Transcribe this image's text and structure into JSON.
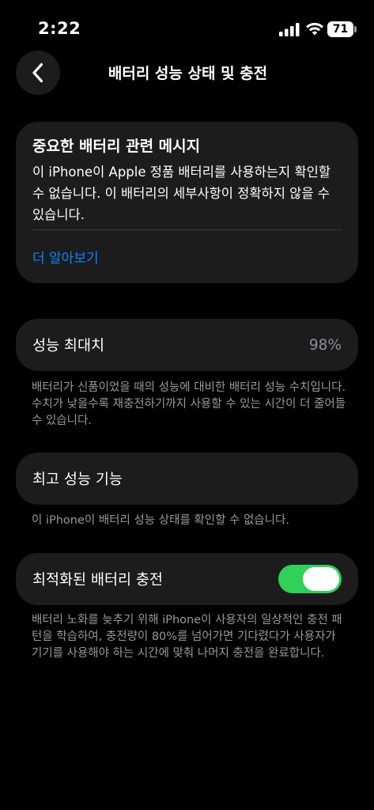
{
  "status_bar": {
    "time": "2:22",
    "battery_level": "71"
  },
  "nav": {
    "title": "배터리 성능 상태 및 충전"
  },
  "important_message": {
    "title": "중요한 배터리 관련 메시지",
    "body": "이 iPhone이 Apple 정품 배터리를 사용하는지 확인할 수 없습니다. 이 배터리의 세부사항이 정확하지 않을 수 있습니다.",
    "link": "더 알아보기",
    "link_color": "#0a84ff"
  },
  "maximum_capacity": {
    "label": "성능 최대치",
    "value": "98%",
    "note": "배터리가 신품이었을 때의 성능에 대비한 배터리 성능 수치입니다. 수치가 낮을수록 재충전하기까지 사용할 수 있는 시간이 더 줄어들 수 있습니다."
  },
  "peak_performance": {
    "label": "최고 성능 기능",
    "note": "이 iPhone이 배터리 성능 상태를 확인할 수 없습니다."
  },
  "optimized_charging": {
    "label": "최적화된 배터리 충전",
    "enabled": true,
    "toggle_color": "#30d158",
    "note": "배터리 노화를 늦추기 위해 iPhone이 사용자의 일상적인 충전 패턴을 학습하여, 충전량이 80%를 넘어가면 기다렸다가 사용자가 기기를 사용해야 하는 시간에 맞춰 나머지 충전을 완료합니다."
  }
}
